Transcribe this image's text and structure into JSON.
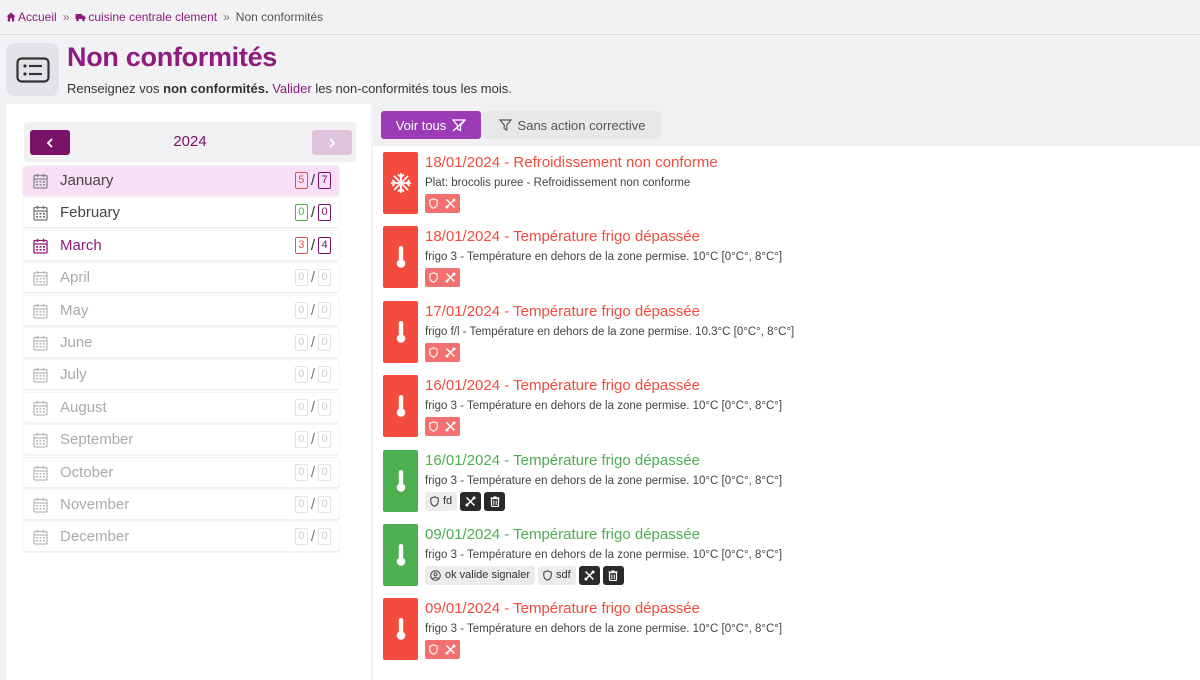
{
  "breadcrumb": {
    "home": "Accueil",
    "site": "cuisine centrale clement",
    "current": "Non conformités",
    "sep": "»"
  },
  "header": {
    "title": "Non conformités",
    "subtitle_pre": "Renseignez vos ",
    "subtitle_bold": "non conformités.",
    "subtitle_link": "Valider",
    "subtitle_post": " les non-conformités tous les mois."
  },
  "calendar": {
    "year": "2024",
    "months": [
      {
        "name": "January",
        "a": "5",
        "b": "7"
      },
      {
        "name": "February",
        "a": "0",
        "b": "0"
      },
      {
        "name": "March",
        "a": "3",
        "b": "4"
      },
      {
        "name": "April",
        "a": "0",
        "b": "0"
      },
      {
        "name": "May",
        "a": "0",
        "b": "0"
      },
      {
        "name": "June",
        "a": "0",
        "b": "0"
      },
      {
        "name": "July",
        "a": "0",
        "b": "0"
      },
      {
        "name": "August",
        "a": "0",
        "b": "0"
      },
      {
        "name": "September",
        "a": "0",
        "b": "0"
      },
      {
        "name": "October",
        "a": "0",
        "b": "0"
      },
      {
        "name": "November",
        "a": "0",
        "b": "0"
      },
      {
        "name": "December",
        "a": "0",
        "b": "0"
      }
    ]
  },
  "filters": {
    "all": "Voir tous",
    "no_corrective": "Sans action corrective"
  },
  "items": [
    {
      "title": "18/01/2024 - Refroidissement non conforme",
      "desc": "Plat: brocolis puree - Refroidissement non conforme",
      "icon": "snowflake-icon"
    },
    {
      "title": "18/01/2024 - Température frigo dépassée",
      "desc": "frigo 3 - Température en dehors de la zone permise. 10°C [0°C°, 8°C°]",
      "icon": "thermometer-icon"
    },
    {
      "title": "17/01/2024 - Température frigo dépassée",
      "desc": "frigo f/l - Température en dehors de la zone permise. 10.3°C [0°C°, 8°C°]",
      "icon": "thermometer-icon"
    },
    {
      "title": "16/01/2024 - Température frigo dépassée",
      "desc": "frigo 3 - Température en dehors de la zone permise. 10°C [0°C°, 8°C°]",
      "icon": "thermometer-icon"
    },
    {
      "title": "16/01/2024 - Température frigo dépassée",
      "desc": "frigo 3 - Température en dehors de la zone permise. 10°C [0°C°, 8°C°]",
      "icon": "thermometer-icon",
      "shield_text": "fd"
    },
    {
      "title": "09/01/2024 - Température frigo dépassée",
      "desc": "frigo 3 - Température en dehors de la zone permise. 10°C [0°C°, 8°C°]",
      "icon": "thermometer-icon",
      "user_text": "ok valide signaler",
      "shield_text": "sdf"
    },
    {
      "title": "09/01/2024 - Température frigo dépassée",
      "desc": "frigo 3 - Température en dehors de la zone permise. 10°C [0°C°, 8°C°]",
      "icon": "thermometer-icon"
    }
  ],
  "colors": {
    "brand": "#8e1b7d",
    "danger": "#f34b3d",
    "success": "#4caf50",
    "filter_active": "#9b3bb5"
  }
}
